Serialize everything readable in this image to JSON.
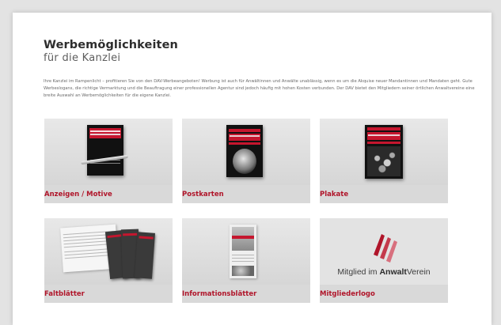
{
  "header": {
    "title": "Werbemöglichkeiten",
    "subtitle": "für die Kanzlei"
  },
  "intro": {
    "text": "Ihre Kanzlei im Rampenlicht – profitieren Sie von den DAV-Werbeangeboten! Werbung ist auch für Anwältinnen und Anwälte unablässig, wenn es um die Akquise neuer Mandantinnen und Mandaten geht. Gute Werbeslogans, die richtige Vermarktung und die Beauftragung einer professionellen Agentur sind jedoch häufig mit hohen Kosten verbunden. Der DAV bietet den Mitgliedern seiner örtlichen Anwaltvereine eine breite Auswahl an Werbemöglichkeiten für die eigene Kanzlei."
  },
  "cards": [
    {
      "label": "Anzeigen / Motive",
      "art_icon": "poster-with-pen"
    },
    {
      "label": "Postkarten",
      "art_icon": "postcard-poster"
    },
    {
      "label": "Plakate",
      "art_icon": "crowd-poster"
    },
    {
      "label": "Faltblätter",
      "art_icon": "folded-leaflets"
    },
    {
      "label": "Informationsblätter",
      "art_icon": "info-sheet"
    },
    {
      "label": "Mitgliederlogo",
      "art_icon": "member-logo"
    }
  ],
  "logo": {
    "prefix": "Mitglied im ",
    "bold": "Anwalt",
    "suffix": "Verein"
  },
  "colors": {
    "accent": "#b0152a",
    "background": "#e3e3e3",
    "card": "#dedede"
  }
}
